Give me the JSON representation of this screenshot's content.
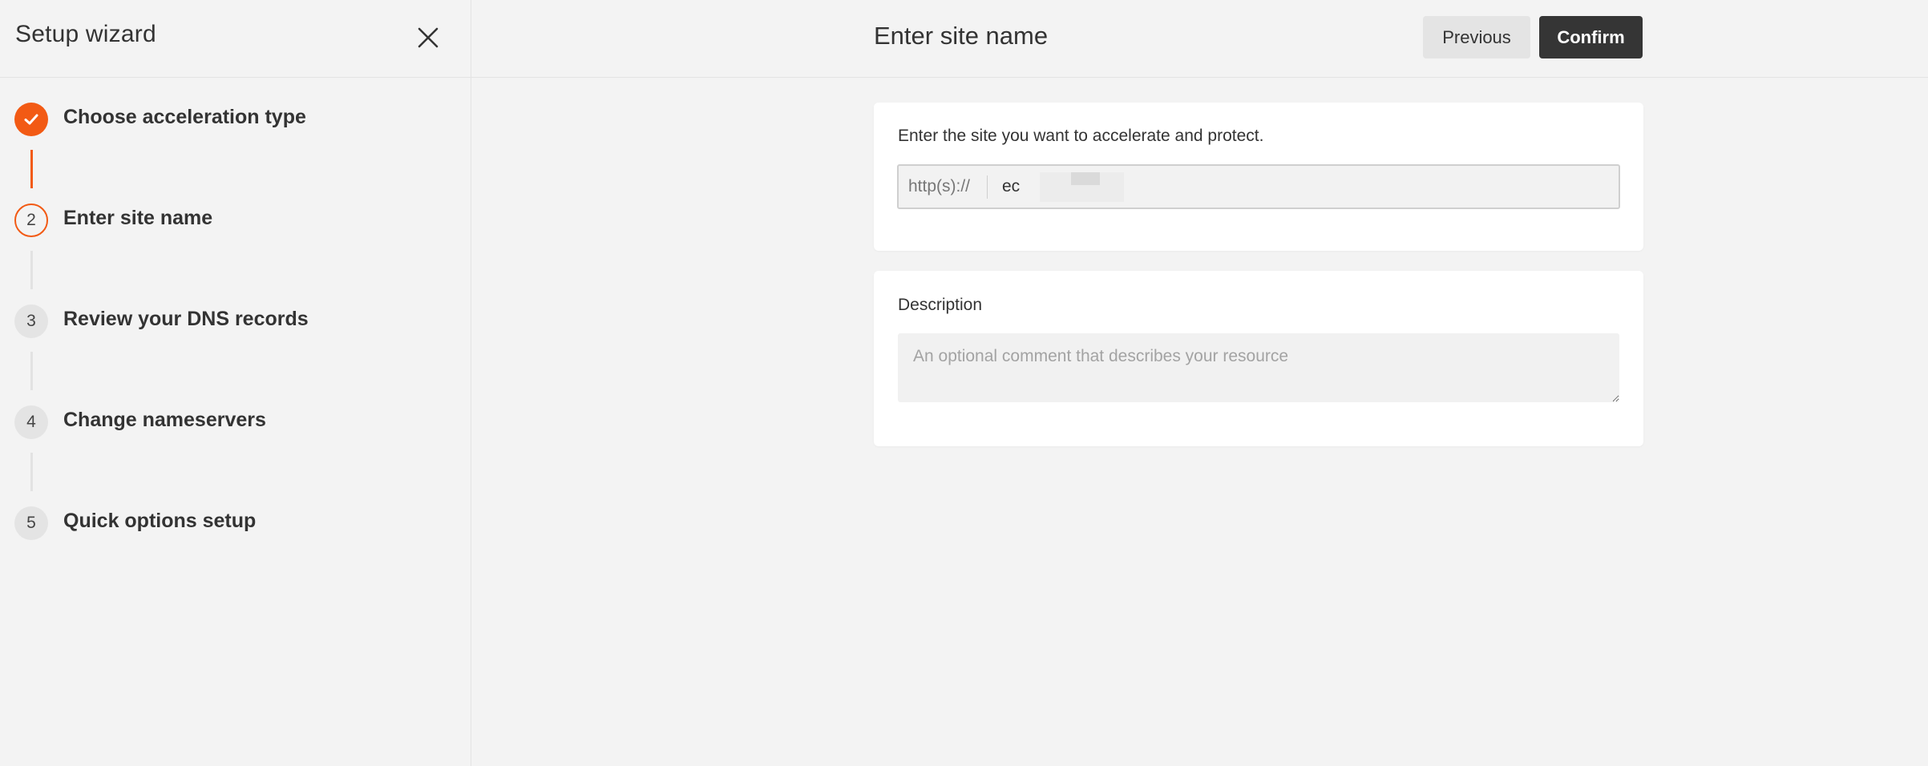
{
  "sidebar": {
    "title": "Setup wizard",
    "steps": [
      {
        "number": "1",
        "label": "Choose acceleration type",
        "status": "completed"
      },
      {
        "number": "2",
        "label": "Enter site name",
        "status": "current"
      },
      {
        "number": "3",
        "label": "Review your DNS records",
        "status": "pending"
      },
      {
        "number": "4",
        "label": "Change nameservers",
        "status": "pending"
      },
      {
        "number": "5",
        "label": "Quick options setup",
        "status": "pending"
      }
    ]
  },
  "header": {
    "title": "Enter site name",
    "previous_label": "Previous",
    "confirm_label": "Confirm"
  },
  "site_card": {
    "label": "Enter the site you want to accelerate and protect.",
    "prefix": "http(s)://",
    "value": "ec"
  },
  "description_card": {
    "label": "Description",
    "placeholder": "An optional comment that describes your resource",
    "value": ""
  },
  "colors": {
    "accent": "#f25a14",
    "primary_button": "#353535",
    "background": "#f3f3f3"
  },
  "icons": {
    "close": "close-icon",
    "completed_step": "check-icon",
    "resize": "resize-handle-icon"
  }
}
